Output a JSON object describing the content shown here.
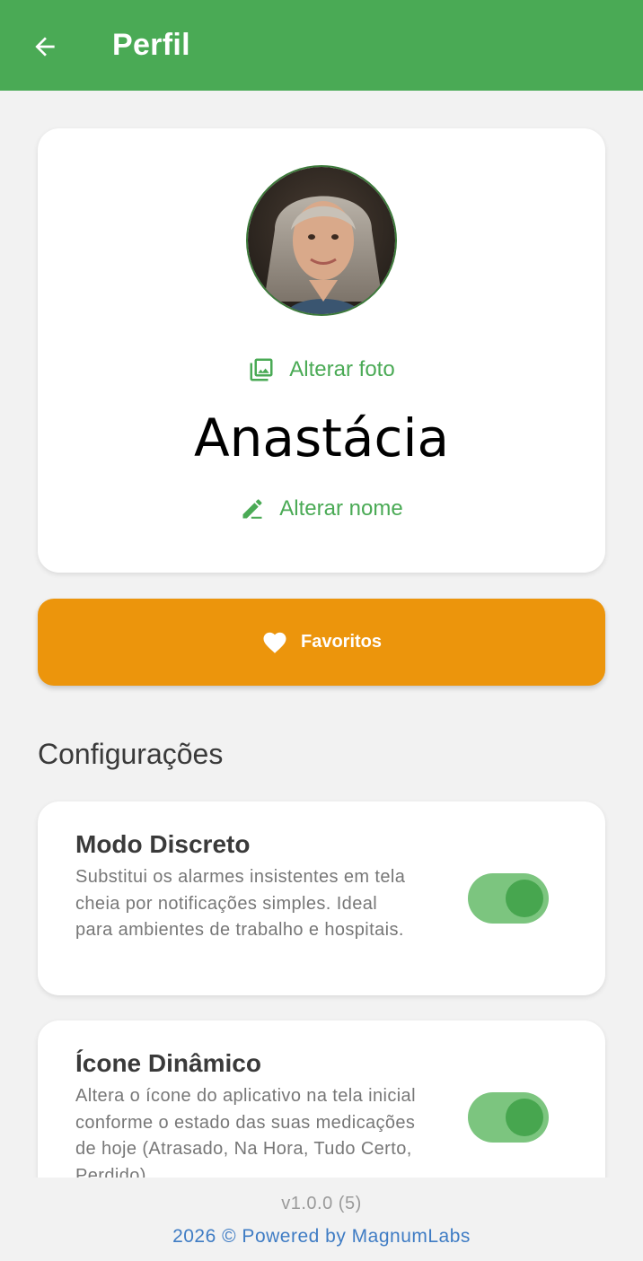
{
  "appbar": {
    "title": "Perfil",
    "back_icon": "arrow-back-icon"
  },
  "profile": {
    "avatar_alt": "profile-photo",
    "change_photo_label": "Alterar foto",
    "change_photo_icon": "image-gallery-icon",
    "name": "Anastácia",
    "change_name_label": "Alterar nome",
    "change_name_icon": "edit-pencil-icon"
  },
  "favorites": {
    "label": "Favoritos",
    "icon": "heart-icon"
  },
  "settings": {
    "section_title": "Configurações",
    "items": [
      {
        "title": "Modo Discreto",
        "description": "Substitui os alarmes insistentes em tela cheia por notificações simples. Ideal para ambientes de trabalho e hospitais.",
        "enabled": true
      },
      {
        "title": "Ícone Dinâmico",
        "description": "Altera o ícone do aplicativo na tela inicial conforme o estado das suas medicações de hoje (Atrasado, Na Hora, Tudo Certo, Perdido)",
        "enabled": true
      }
    ]
  },
  "footer": {
    "version": "v1.0.0 (5)",
    "powered": "2026 © Powered by MagnumLabs"
  },
  "colors": {
    "primary": "#4aaa55",
    "accent": "#ec950c",
    "link": "#3f7cc4"
  }
}
